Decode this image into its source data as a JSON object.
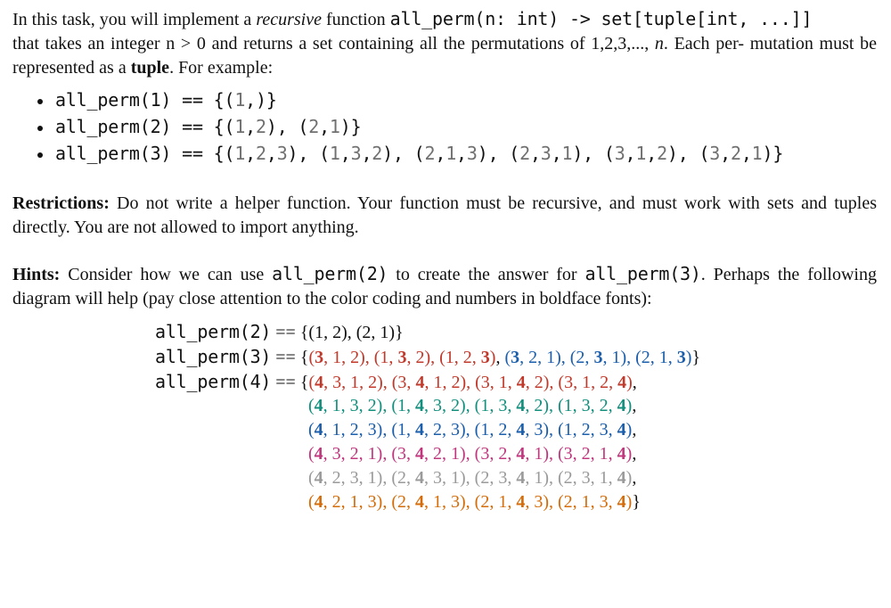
{
  "intro": {
    "pre1": "In this task, you will implement a ",
    "recursive": "recursive",
    "pre2": " function ",
    "sig": "all_perm(n: int) -> set[tuple[int, ...]]",
    "line2a": "that takes an integer ",
    "ngt0": "n > 0",
    "line2b": " and returns a set containing all the permutations of 1,2,3,..., ",
    "nvar": "n",
    "line2c": ". Each per-",
    "line3a": "mutation must be represented as a ",
    "tuple": "tuple",
    "line3b": ". For example:"
  },
  "examples": {
    "e1call": "all_perm(1)",
    "e1eq": " == ",
    "e1set": "{(1,)}",
    "e2call": "all_perm(2)",
    "e2eq": " == ",
    "e2set": "{(1,2), (2,1)}",
    "e3call": "all_perm(3)",
    "e3eq": " == ",
    "e3set": "{(1,2,3), (1,3,2), (2,1,3), (2,3,1), (3,1,2), (3,2,1)}"
  },
  "restrictions": {
    "label": "Restrictions:",
    "text": "   Do not write a helper function. Your function must be recursive, and must work with sets and tuples directly. You are not allowed to import anything."
  },
  "hints": {
    "label": "Hints:",
    "t1": "   Consider how we can use ",
    "c2": "all_perm(2)",
    "t2": " to create the answer for ",
    "c3": "all_perm(3)",
    "t3": ". Perhaps the following diagram will help (pay close attention to the color coding and numbers in boldface fonts):"
  },
  "diagram": {
    "l2": {
      "call": "all_perm(2)",
      "eq": " == ",
      "body": "{(1, 2), (2, 1)}"
    },
    "l3": {
      "call": "all_perm(3)",
      "eq": " == "
    },
    "l4": {
      "call": "all_perm(4)",
      "eq": " == "
    }
  }
}
